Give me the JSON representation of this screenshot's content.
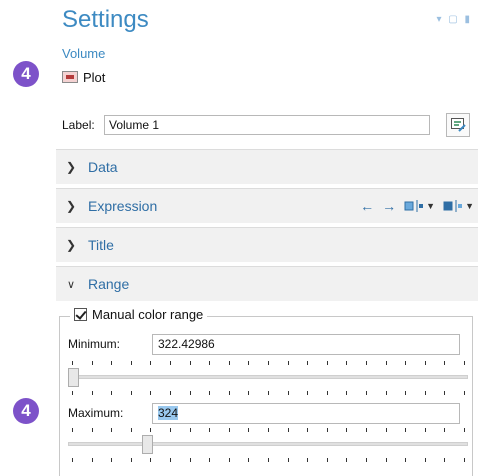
{
  "badges": {
    "top": "4",
    "bottom": "4"
  },
  "header": {
    "title": "Settings",
    "subtitle": "Volume",
    "window_controls": "▾ ▢ ▮"
  },
  "plot": {
    "label": "Plot"
  },
  "label_field": {
    "caption": "Label:",
    "value": "Volume 1"
  },
  "sections": [
    {
      "label": "Data",
      "expanded": false
    },
    {
      "label": "Expression",
      "expanded": false
    },
    {
      "label": "Title",
      "expanded": false
    },
    {
      "label": "Range",
      "expanded": true
    }
  ],
  "expression_toolbar": [
    "arrow-left-icon",
    "arrow-right-icon",
    "insert-expression-icon",
    "replace-expression-icon"
  ],
  "range": {
    "manual_color_range_label": "Manual color range",
    "manual_color_range_checked": true,
    "minimum_label": "Minimum:",
    "minimum_value": "322.42986",
    "minimum_slider_fraction": 0.0,
    "maximum_label": "Maximum:",
    "maximum_value": "324",
    "maximum_slider_fraction": 0.19
  },
  "colors": {
    "accent": "#3d8ac2",
    "section_bg": "#f1f1f1",
    "badge": "#7d52c9",
    "selection": "#99c8ee"
  }
}
